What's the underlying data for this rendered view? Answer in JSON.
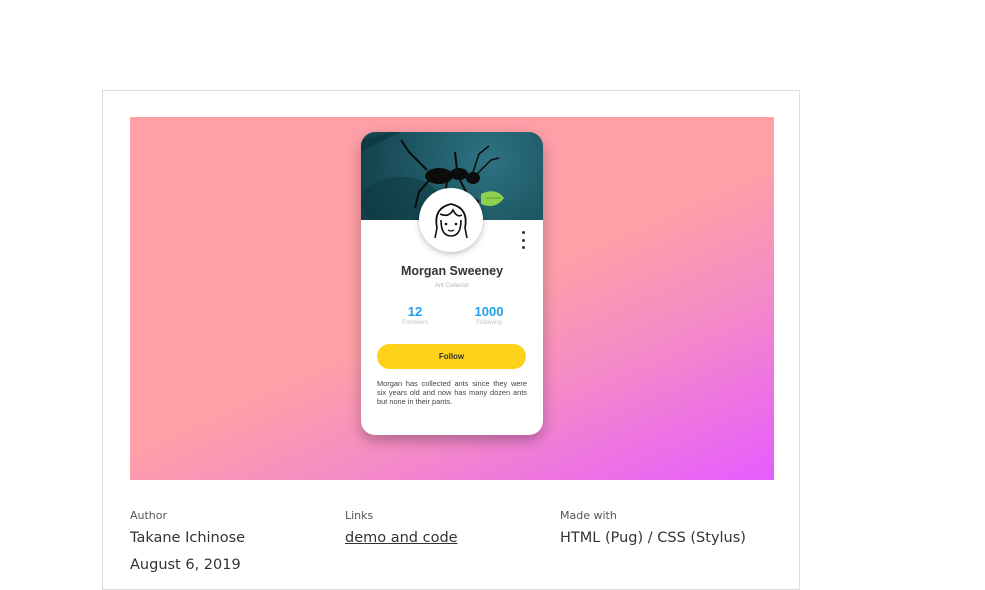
{
  "profile_card": {
    "name": "Morgan Sweeney",
    "role": "Ant Collector",
    "stats": [
      {
        "value": "12",
        "label": "Followers"
      },
      {
        "value": "1000",
        "label": "Following"
      }
    ],
    "follow_label": "Follow",
    "bio": "Morgan has collected ants since they were six years old and now has many dozen ants but none in their pants."
  },
  "meta": {
    "author_label": "Author",
    "author_name": "Takane Ichinose",
    "date": "August 6, 2019",
    "links_label": "Links",
    "links_value": "demo and code",
    "made_with_label": "Made with",
    "made_with_value": "HTML (Pug) / CSS (Stylus)"
  },
  "colors": {
    "accent_blue": "#1d9ef0",
    "follow_yellow": "#ffd21a",
    "preview_pink": "#ff9fa8",
    "preview_purple": "#e65cff"
  }
}
